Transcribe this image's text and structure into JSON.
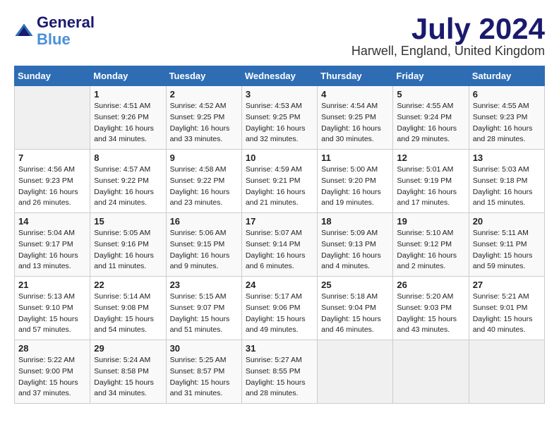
{
  "header": {
    "logo_line1": "General",
    "logo_line2": "Blue",
    "month_year": "July 2024",
    "location": "Harwell, England, United Kingdom"
  },
  "weekdays": [
    "Sunday",
    "Monday",
    "Tuesday",
    "Wednesday",
    "Thursday",
    "Friday",
    "Saturday"
  ],
  "weeks": [
    [
      {
        "day": "",
        "sunrise": "",
        "sunset": "",
        "daylight": ""
      },
      {
        "day": "1",
        "sunrise": "Sunrise: 4:51 AM",
        "sunset": "Sunset: 9:26 PM",
        "daylight": "Daylight: 16 hours and 34 minutes."
      },
      {
        "day": "2",
        "sunrise": "Sunrise: 4:52 AM",
        "sunset": "Sunset: 9:25 PM",
        "daylight": "Daylight: 16 hours and 33 minutes."
      },
      {
        "day": "3",
        "sunrise": "Sunrise: 4:53 AM",
        "sunset": "Sunset: 9:25 PM",
        "daylight": "Daylight: 16 hours and 32 minutes."
      },
      {
        "day": "4",
        "sunrise": "Sunrise: 4:54 AM",
        "sunset": "Sunset: 9:25 PM",
        "daylight": "Daylight: 16 hours and 30 minutes."
      },
      {
        "day": "5",
        "sunrise": "Sunrise: 4:55 AM",
        "sunset": "Sunset: 9:24 PM",
        "daylight": "Daylight: 16 hours and 29 minutes."
      },
      {
        "day": "6",
        "sunrise": "Sunrise: 4:55 AM",
        "sunset": "Sunset: 9:23 PM",
        "daylight": "Daylight: 16 hours and 28 minutes."
      }
    ],
    [
      {
        "day": "7",
        "sunrise": "Sunrise: 4:56 AM",
        "sunset": "Sunset: 9:23 PM",
        "daylight": "Daylight: 16 hours and 26 minutes."
      },
      {
        "day": "8",
        "sunrise": "Sunrise: 4:57 AM",
        "sunset": "Sunset: 9:22 PM",
        "daylight": "Daylight: 16 hours and 24 minutes."
      },
      {
        "day": "9",
        "sunrise": "Sunrise: 4:58 AM",
        "sunset": "Sunset: 9:22 PM",
        "daylight": "Daylight: 16 hours and 23 minutes."
      },
      {
        "day": "10",
        "sunrise": "Sunrise: 4:59 AM",
        "sunset": "Sunset: 9:21 PM",
        "daylight": "Daylight: 16 hours and 21 minutes."
      },
      {
        "day": "11",
        "sunrise": "Sunrise: 5:00 AM",
        "sunset": "Sunset: 9:20 PM",
        "daylight": "Daylight: 16 hours and 19 minutes."
      },
      {
        "day": "12",
        "sunrise": "Sunrise: 5:01 AM",
        "sunset": "Sunset: 9:19 PM",
        "daylight": "Daylight: 16 hours and 17 minutes."
      },
      {
        "day": "13",
        "sunrise": "Sunrise: 5:03 AM",
        "sunset": "Sunset: 9:18 PM",
        "daylight": "Daylight: 16 hours and 15 minutes."
      }
    ],
    [
      {
        "day": "14",
        "sunrise": "Sunrise: 5:04 AM",
        "sunset": "Sunset: 9:17 PM",
        "daylight": "Daylight: 16 hours and 13 minutes."
      },
      {
        "day": "15",
        "sunrise": "Sunrise: 5:05 AM",
        "sunset": "Sunset: 9:16 PM",
        "daylight": "Daylight: 16 hours and 11 minutes."
      },
      {
        "day": "16",
        "sunrise": "Sunrise: 5:06 AM",
        "sunset": "Sunset: 9:15 PM",
        "daylight": "Daylight: 16 hours and 9 minutes."
      },
      {
        "day": "17",
        "sunrise": "Sunrise: 5:07 AM",
        "sunset": "Sunset: 9:14 PM",
        "daylight": "Daylight: 16 hours and 6 minutes."
      },
      {
        "day": "18",
        "sunrise": "Sunrise: 5:09 AM",
        "sunset": "Sunset: 9:13 PM",
        "daylight": "Daylight: 16 hours and 4 minutes."
      },
      {
        "day": "19",
        "sunrise": "Sunrise: 5:10 AM",
        "sunset": "Sunset: 9:12 PM",
        "daylight": "Daylight: 16 hours and 2 minutes."
      },
      {
        "day": "20",
        "sunrise": "Sunrise: 5:11 AM",
        "sunset": "Sunset: 9:11 PM",
        "daylight": "Daylight: 15 hours and 59 minutes."
      }
    ],
    [
      {
        "day": "21",
        "sunrise": "Sunrise: 5:13 AM",
        "sunset": "Sunset: 9:10 PM",
        "daylight": "Daylight: 15 hours and 57 minutes."
      },
      {
        "day": "22",
        "sunrise": "Sunrise: 5:14 AM",
        "sunset": "Sunset: 9:08 PM",
        "daylight": "Daylight: 15 hours and 54 minutes."
      },
      {
        "day": "23",
        "sunrise": "Sunrise: 5:15 AM",
        "sunset": "Sunset: 9:07 PM",
        "daylight": "Daylight: 15 hours and 51 minutes."
      },
      {
        "day": "24",
        "sunrise": "Sunrise: 5:17 AM",
        "sunset": "Sunset: 9:06 PM",
        "daylight": "Daylight: 15 hours and 49 minutes."
      },
      {
        "day": "25",
        "sunrise": "Sunrise: 5:18 AM",
        "sunset": "Sunset: 9:04 PM",
        "daylight": "Daylight: 15 hours and 46 minutes."
      },
      {
        "day": "26",
        "sunrise": "Sunrise: 5:20 AM",
        "sunset": "Sunset: 9:03 PM",
        "daylight": "Daylight: 15 hours and 43 minutes."
      },
      {
        "day": "27",
        "sunrise": "Sunrise: 5:21 AM",
        "sunset": "Sunset: 9:01 PM",
        "daylight": "Daylight: 15 hours and 40 minutes."
      }
    ],
    [
      {
        "day": "28",
        "sunrise": "Sunrise: 5:22 AM",
        "sunset": "Sunset: 9:00 PM",
        "daylight": "Daylight: 15 hours and 37 minutes."
      },
      {
        "day": "29",
        "sunrise": "Sunrise: 5:24 AM",
        "sunset": "Sunset: 8:58 PM",
        "daylight": "Daylight: 15 hours and 34 minutes."
      },
      {
        "day": "30",
        "sunrise": "Sunrise: 5:25 AM",
        "sunset": "Sunset: 8:57 PM",
        "daylight": "Daylight: 15 hours and 31 minutes."
      },
      {
        "day": "31",
        "sunrise": "Sunrise: 5:27 AM",
        "sunset": "Sunset: 8:55 PM",
        "daylight": "Daylight: 15 hours and 28 minutes."
      },
      {
        "day": "",
        "sunrise": "",
        "sunset": "",
        "daylight": ""
      },
      {
        "day": "",
        "sunrise": "",
        "sunset": "",
        "daylight": ""
      },
      {
        "day": "",
        "sunrise": "",
        "sunset": "",
        "daylight": ""
      }
    ]
  ]
}
